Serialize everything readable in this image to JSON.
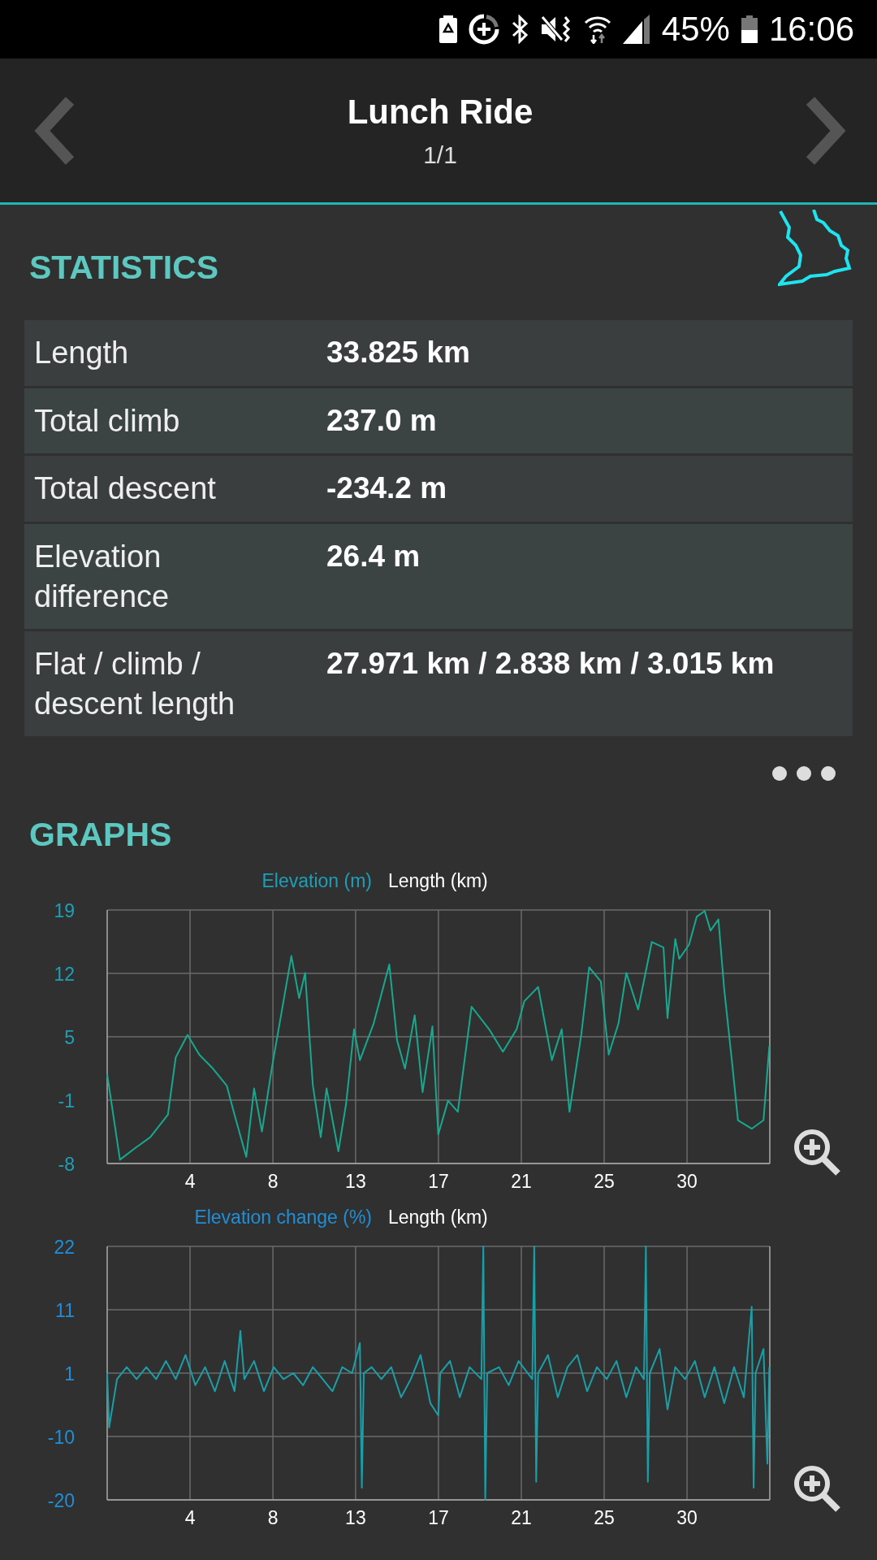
{
  "status_bar": {
    "battery": "45%",
    "time": "16:06"
  },
  "header": {
    "title": "Lunch Ride",
    "subtitle": "1/1"
  },
  "statistics": {
    "title": "STATISTICS",
    "rows": [
      {
        "label": "Length",
        "value": "33.825 km"
      },
      {
        "label": "Total climb",
        "value": "237.0 m"
      },
      {
        "label": "Total descent",
        "value": "-234.2 m"
      },
      {
        "label": "Elevation difference",
        "value": "26.4 m"
      },
      {
        "label": "Flat / climb / descent length",
        "value": "27.971 km / 2.838 km / 3.015 km"
      }
    ]
  },
  "graphs": {
    "title": "GRAPHS",
    "charts": [
      {
        "chart_data": {
          "type": "line",
          "grid": true,
          "ylabel": "Elevation (m)",
          "xlabel": "Length (km)",
          "xlim": [
            0,
            33.825
          ],
          "ylim": [
            -8,
            19
          ],
          "xticks": [
            {
              "value": 4.23,
              "label": "4"
            },
            {
              "value": 8.46,
              "label": "8"
            },
            {
              "value": 12.68,
              "label": "13"
            },
            {
              "value": 16.91,
              "label": "17"
            },
            {
              "value": 21.14,
              "label": "21"
            },
            {
              "value": 25.37,
              "label": "25"
            },
            {
              "value": 29.6,
              "label": "30"
            }
          ],
          "yticks": [
            {
              "value": -8,
              "label": "-8"
            },
            {
              "value": -1.25,
              "label": "-1"
            },
            {
              "value": 5.5,
              "label": "5"
            },
            {
              "value": 12.25,
              "label": "12"
            },
            {
              "value": 19,
              "label": "19"
            }
          ],
          "x": [
            0,
            0.65,
            1.4,
            2.2,
            3.1,
            3.5,
            4.1,
            4.7,
            5.4,
            6.1,
            6.5,
            7.1,
            7.5,
            7.9,
            8.4,
            8.8,
            9.4,
            9.8,
            10.1,
            10.5,
            10.9,
            11.2,
            11.8,
            12.2,
            12.6,
            12.9,
            13.6,
            14.4,
            14.8,
            15.2,
            15.7,
            16.1,
            16.6,
            16.9,
            17.4,
            17.9,
            18.6,
            19.5,
            20.2,
            20.9,
            21.3,
            22.0,
            22.7,
            23.2,
            23.6,
            24.2,
            24.6,
            25.2,
            25.6,
            26.1,
            26.5,
            27.1,
            27.8,
            28.4,
            28.6,
            29.0,
            29.2,
            29.7,
            30.1,
            30.5,
            30.8,
            31.2,
            31.5,
            31.9,
            32.2,
            32.9,
            33.5,
            33.8
          ],
          "series": [
            {
              "color": "#17a890",
              "values": [
                1.5,
                -7.6,
                -6.4,
                -5.2,
                -2.8,
                3.3,
                5.7,
                3.6,
                2.1,
                0.3,
                -2.8,
                -7.3,
                0,
                -4.6,
                2.1,
                6.9,
                14.1,
                9.6,
                12.3,
                0.3,
                -5.2,
                0,
                -6.7,
                -1.6,
                6.3,
                3.0,
                6.9,
                13.2,
                5.1,
                2.1,
                7.8,
                -0.4,
                6.6,
                -4.9,
                -1.3,
                -2.5,
                8.7,
                6.3,
                3.9,
                6.3,
                9.3,
                10.8,
                3.0,
                6.3,
                -2.5,
                5.7,
                12.9,
                11.4,
                3.6,
                6.9,
                12.3,
                8.4,
                15.6,
                15.0,
                7.5,
                15.9,
                13.8,
                15.3,
                18.3,
                18.9,
                16.8,
                18.0,
                10.5,
                2.7,
                -3.4,
                -4.3,
                -3.4,
                4.5
              ]
            }
          ]
        }
      },
      {
        "chart_data": {
          "type": "line",
          "grid": true,
          "ylabel": "Elevation change (%)",
          "xlabel": "Length (km)",
          "xlim": [
            0,
            33.825
          ],
          "ylim": [
            -20,
            22
          ],
          "xticks": [
            {
              "value": 4.23,
              "label": "4"
            },
            {
              "value": 8.46,
              "label": "8"
            },
            {
              "value": 12.68,
              "label": "13"
            },
            {
              "value": 16.91,
              "label": "17"
            },
            {
              "value": 21.14,
              "label": "21"
            },
            {
              "value": 25.37,
              "label": "25"
            },
            {
              "value": 29.6,
              "label": "30"
            }
          ],
          "yticks": [
            {
              "value": -20,
              "label": "-20"
            },
            {
              "value": -9.5,
              "label": "-10"
            },
            {
              "value": 1,
              "label": "1"
            },
            {
              "value": 11.5,
              "label": "11"
            },
            {
              "value": 22,
              "label": "22"
            }
          ],
          "x": [
            0,
            0.1,
            0.5,
            1,
            1.5,
            2,
            2.5,
            3,
            3.5,
            4,
            4.5,
            5,
            5.5,
            6,
            6.5,
            6.8,
            7,
            7.5,
            8,
            8.5,
            9,
            9.5,
            10,
            10.5,
            11,
            11.5,
            12,
            12.5,
            12.9,
            13,
            13.1,
            13.5,
            14,
            14.5,
            15,
            15.5,
            16,
            16.5,
            16.9,
            17,
            17.5,
            18,
            18.5,
            19.1,
            19.2,
            19.3,
            19.4,
            20,
            20.5,
            21,
            21.7,
            21.8,
            21.9,
            22,
            22.5,
            23,
            23.5,
            24,
            24.5,
            25,
            25.5,
            26,
            26.5,
            27,
            27.4,
            27.5,
            27.6,
            27.7,
            28.2,
            28.6,
            29,
            29.5,
            30,
            30.5,
            31,
            31.5,
            32,
            32.5,
            32.9,
            33,
            33.1,
            33.5,
            33.7,
            33.8
          ],
          "series": [
            {
              "color": "#1a9fa8",
              "values": [
                1,
                -8,
                0,
                2,
                0,
                2,
                0,
                3,
                0,
                4,
                -1,
                2,
                -2,
                3,
                -2,
                8,
                0,
                3,
                -2,
                2,
                0,
                1,
                -1,
                2,
                0,
                -2,
                2,
                1,
                6,
                -18,
                1,
                2,
                0,
                2,
                -3,
                0,
                4,
                -4,
                -6,
                1,
                3,
                -3,
                2,
                0,
                22,
                -20,
                1,
                2,
                -1,
                3,
                0,
                22,
                -17,
                1,
                4,
                -3,
                2,
                4,
                -2,
                2,
                0,
                3,
                -3,
                2,
                0,
                22,
                -17,
                1,
                5,
                -5,
                2,
                0,
                3,
                -3,
                2,
                -4,
                2,
                -3,
                12,
                -18,
                1,
                5,
                -14,
                2
              ]
            }
          ]
        }
      }
    ]
  }
}
